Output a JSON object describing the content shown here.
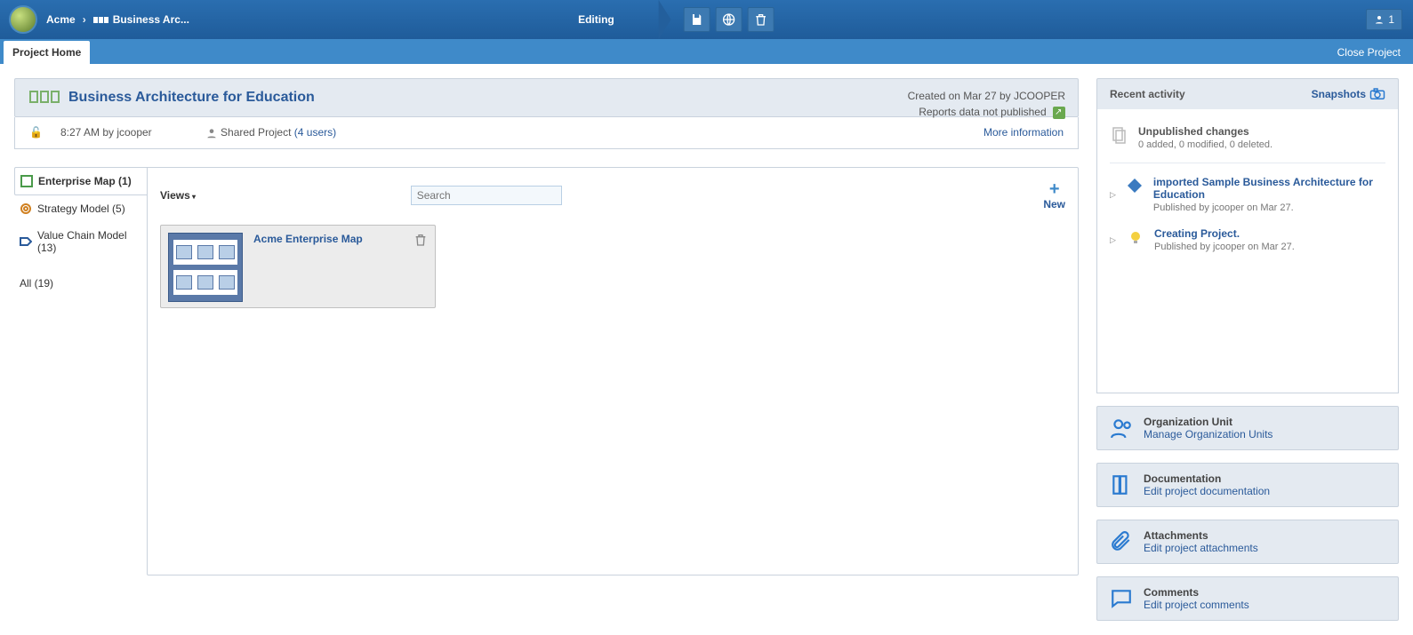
{
  "topbar": {
    "crumb_root": "Acme",
    "crumb_current": "Business Arc...",
    "editing_label": "Editing",
    "user_count": "1"
  },
  "row2": {
    "tab_label": "Project Home",
    "close_label": "Close Project"
  },
  "title_card": {
    "project_title": "Business Architecture for Education",
    "created_line": "Created on Mar 27 by JCOOPER",
    "publish_line": "Reports data not published"
  },
  "sub_row": {
    "time_by": "8:27 AM by jcooper",
    "shared_label": "Shared Project",
    "users_link": "(4 users)",
    "more_info": "More information"
  },
  "side_nav": {
    "items": [
      {
        "label": "Enterprise Map (1)"
      },
      {
        "label": "Strategy Model (5)"
      },
      {
        "label": "Value Chain Model (13)"
      },
      {
        "label": "All (19)"
      }
    ]
  },
  "content": {
    "views_label": "Views",
    "search_placeholder": "Search",
    "new_label": "New",
    "card_title": "Acme Enterprise Map"
  },
  "recent": {
    "header": "Recent activity",
    "snapshots": "Snapshots",
    "unpublished_title": "Unpublished changes",
    "unpublished_sub": "0 added, 0 modified, 0 deleted.",
    "item1_title": "imported Sample Business Architecture for Education",
    "item1_sub": "Published by jcooper on Mar 27.",
    "item2_title": "Creating Project.",
    "item2_sub": "Published by jcooper on Mar 27."
  },
  "actions": {
    "org_t1": "Organization Unit",
    "org_t2": "Manage Organization Units",
    "doc_t1": "Documentation",
    "doc_t2": "Edit project documentation",
    "att_t1": "Attachments",
    "att_t2": "Edit project attachments",
    "com_t1": "Comments",
    "com_t2": "Edit project comments"
  }
}
